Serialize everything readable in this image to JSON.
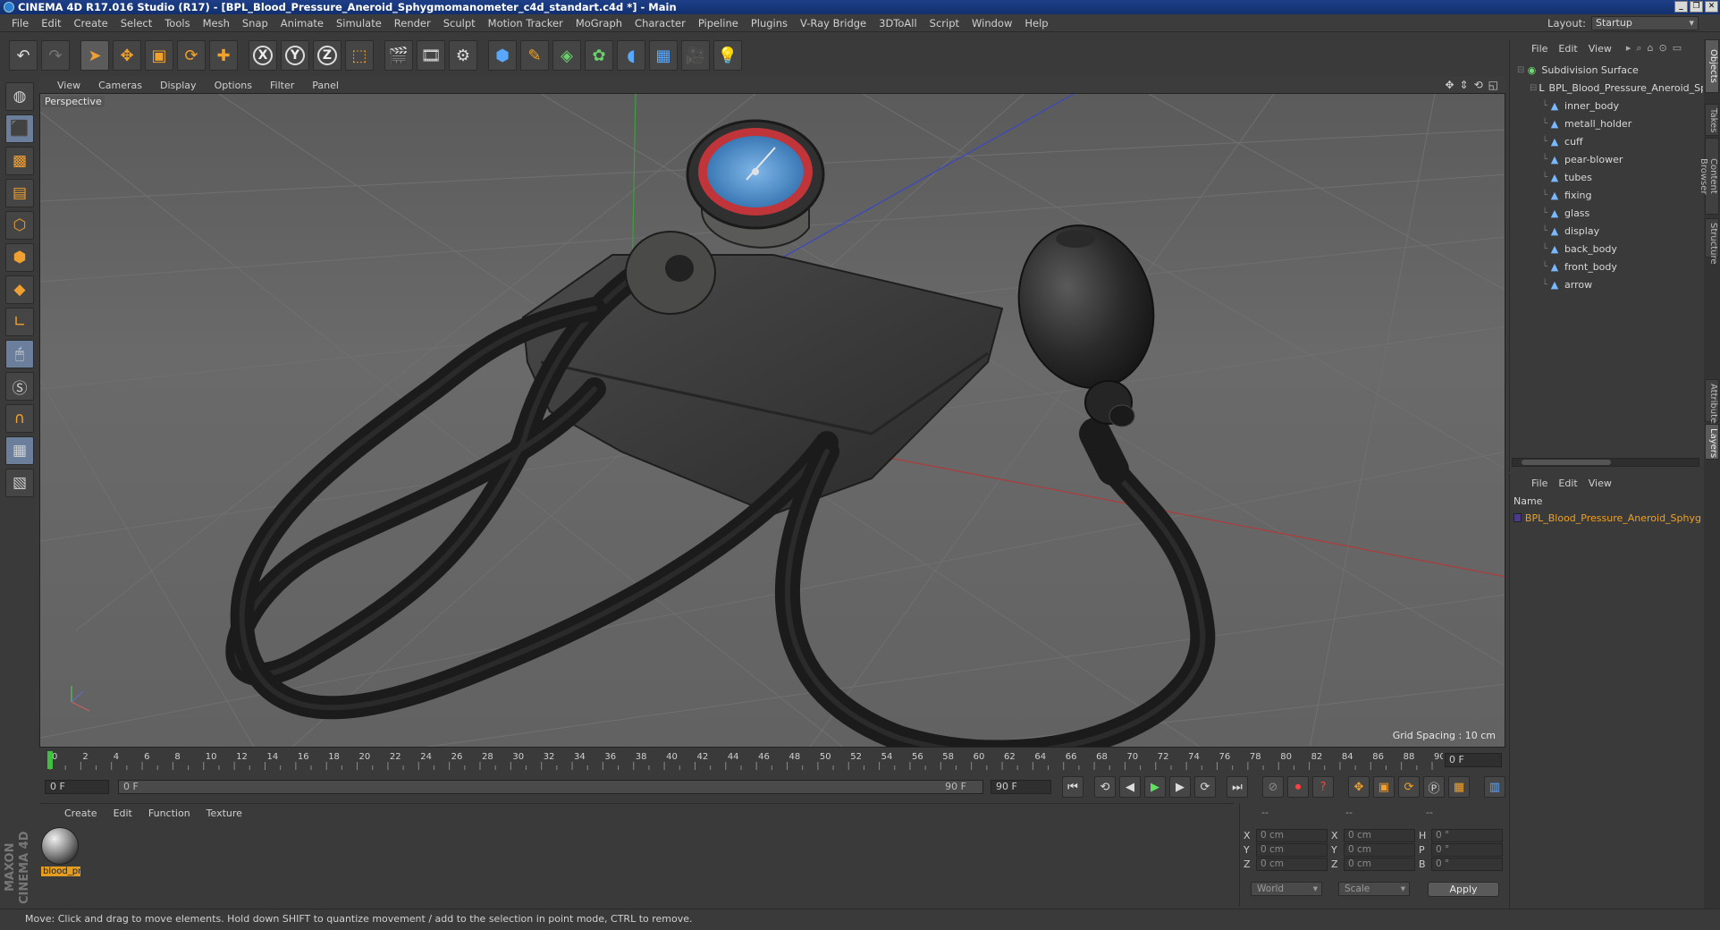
{
  "window": {
    "title": "CINEMA 4D R17.016 Studio (R17) - [BPL_Blood_Pressure_Aneroid_Sphygmomanometer_c4d_standart.c4d *] - Main",
    "controls": [
      "_",
      "❐",
      "✕"
    ]
  },
  "menu": [
    "File",
    "Edit",
    "Create",
    "Select",
    "Tools",
    "Mesh",
    "Snap",
    "Animate",
    "Simulate",
    "Render",
    "Sculpt",
    "Motion Tracker",
    "MoGraph",
    "Character",
    "Pipeline",
    "Plugins",
    "V-Ray Bridge",
    "3DToAll",
    "Script",
    "Window",
    "Help"
  ],
  "layout": {
    "label": "Layout:",
    "value": "Startup"
  },
  "toolbar_icons": [
    "undo-icon",
    "redo-icon",
    "select-arrow-icon",
    "move-icon",
    "scale-icon",
    "rotate-icon",
    "add-icon",
    "x-axis-icon",
    "y-axis-icon",
    "z-axis-icon",
    "coordinate-system-icon",
    "render-view-icon",
    "render-picture-viewer-icon",
    "render-settings-icon",
    "cube-icon",
    "pen-icon",
    "subdivision-icon",
    "cloner-icon",
    "deformer-icon",
    "floor-icon",
    "camera-icon",
    "light-icon"
  ],
  "viewport": {
    "menu": [
      "View",
      "Cameras",
      "Display",
      "Options",
      "Filter",
      "Panel"
    ],
    "label": "Perspective",
    "grid_spacing": "Grid Spacing : 10 cm"
  },
  "timeline": {
    "ticks": [
      "0",
      "2",
      "4",
      "6",
      "8",
      "10",
      "12",
      "14",
      "16",
      "18",
      "20",
      "22",
      "24",
      "26",
      "28",
      "30",
      "32",
      "34",
      "36",
      "38",
      "40",
      "42",
      "44",
      "46",
      "48",
      "50",
      "52",
      "54",
      "56",
      "58",
      "60",
      "62",
      "64",
      "66",
      "68",
      "70",
      "72",
      "74",
      "76",
      "78",
      "80",
      "82",
      "84",
      "86",
      "88",
      "90"
    ],
    "current_frame": "0 F",
    "start_frame": "0 F",
    "range_start": "0 F",
    "range_end": "90 F",
    "end_frame": "90 F"
  },
  "materials": {
    "menu": [
      "Create",
      "Edit",
      "Function",
      "Texture"
    ],
    "items": [
      {
        "name": "blood_pr"
      }
    ]
  },
  "coordinates": {
    "headers": [
      "--",
      "--",
      "--"
    ],
    "rows": [
      {
        "l1": "X",
        "v1": "0 cm",
        "l2": "X",
        "v2": "0 cm",
        "l3": "H",
        "v3": "0 °"
      },
      {
        "l1": "Y",
        "v1": "0 cm",
        "l2": "Y",
        "v2": "0 cm",
        "l3": "P",
        "v3": "0 °"
      },
      {
        "l1": "Z",
        "v1": "0 cm",
        "l2": "Z",
        "v2": "0 cm",
        "l3": "B",
        "v3": "0 °"
      }
    ],
    "mode": "World",
    "scale": "Scale",
    "apply_label": "Apply"
  },
  "objects": {
    "menu": [
      "File",
      "Edit",
      "View"
    ],
    "tree": [
      {
        "name": "Subdivision Surface",
        "depth": 0,
        "icon": "green"
      },
      {
        "name": "BPL_Blood_Pressure_Aneroid_Sphy",
        "depth": 1,
        "icon": "white"
      },
      {
        "name": "inner_body",
        "depth": 2,
        "icon": "poly"
      },
      {
        "name": "metall_holder",
        "depth": 2,
        "icon": "poly"
      },
      {
        "name": "cuff",
        "depth": 2,
        "icon": "poly"
      },
      {
        "name": "pear-blower",
        "depth": 2,
        "icon": "poly"
      },
      {
        "name": "tubes",
        "depth": 2,
        "icon": "poly"
      },
      {
        "name": "fixing",
        "depth": 2,
        "icon": "poly"
      },
      {
        "name": "glass",
        "depth": 2,
        "icon": "poly"
      },
      {
        "name": "display",
        "depth": 2,
        "icon": "poly"
      },
      {
        "name": "back_body",
        "depth": 2,
        "icon": "poly"
      },
      {
        "name": "front_body",
        "depth": 2,
        "icon": "poly"
      },
      {
        "name": "arrow",
        "depth": 2,
        "icon": "poly"
      }
    ]
  },
  "layers": {
    "menu": [
      "File",
      "Edit",
      "View"
    ],
    "header": "Name",
    "row": "BPL_Blood_Pressure_Aneroid_Sphyg"
  },
  "right_tabs": [
    "Objects",
    "Takes",
    "Content Browser",
    "Structure",
    "Attributes",
    "Layers"
  ],
  "status": "Move: Click and drag to move elements. Hold down SHIFT to quantize movement / add to the selection in point mode, CTRL to remove.",
  "logo": "MAXON CINEMA 4D"
}
